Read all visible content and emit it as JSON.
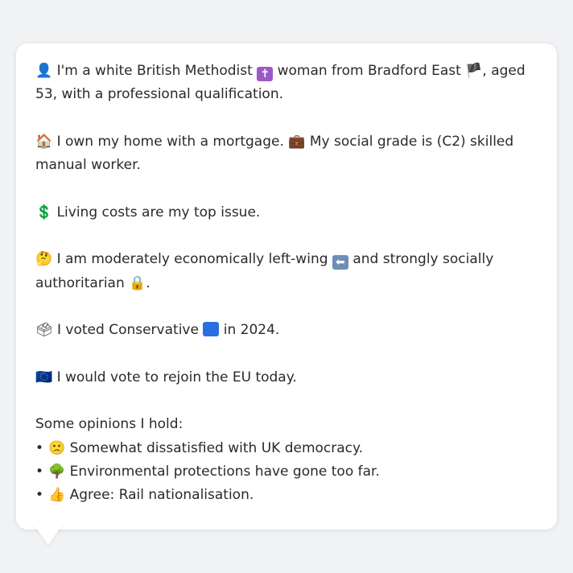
{
  "profile": {
    "line1": {
      "person_icon": "👤",
      "text_a": " I'm a white British Methodist ",
      "cross_icon": "✝",
      "text_b": " woman from Bradford East ",
      "flag_icon": "🏴",
      "text_c": ", aged 53, with a professional qualification."
    },
    "line2": {
      "house_icon": "🏠",
      "text_a": " I own my home with a mortgage. ",
      "briefcase_icon": "💼",
      "text_b": " My social grade is (C2) skilled manual worker."
    },
    "line3": {
      "dollar_icon": "💲",
      "text": " Living costs are my top issue."
    },
    "line4": {
      "thinking_icon": "🤔",
      "text_a": " I am moderately economically left-wing ",
      "left_arrow_icon": "⬅",
      "text_b": " and strongly socially authoritarian ",
      "lock_icon": "🔒",
      "text_c": "."
    },
    "line5": {
      "ballot_icon": "🗳",
      "text_a": " I voted Conservative ",
      "blue_square_icon": "",
      "text_b": " in 2024."
    },
    "line6": {
      "eu_icon": "🇪🇺",
      "text": " I would vote to rejoin the EU today."
    },
    "opinions_heading": "Some opinions I hold:",
    "opinions": [
      {
        "bullet": "•",
        "icon": "🙁",
        "text": " Somewhat dissatisfied with UK democracy."
      },
      {
        "bullet": "•",
        "icon": "🌳",
        "text": " Environmental protections have gone too far."
      },
      {
        "bullet": "•",
        "icon": "👍",
        "text": " Agree: Rail nationalisation."
      }
    ]
  },
  "colors": {
    "background": "#f1f2f4",
    "card": "#ffffff",
    "text": "#2a2a2a",
    "conservative_blue": "#2a6fe0"
  }
}
